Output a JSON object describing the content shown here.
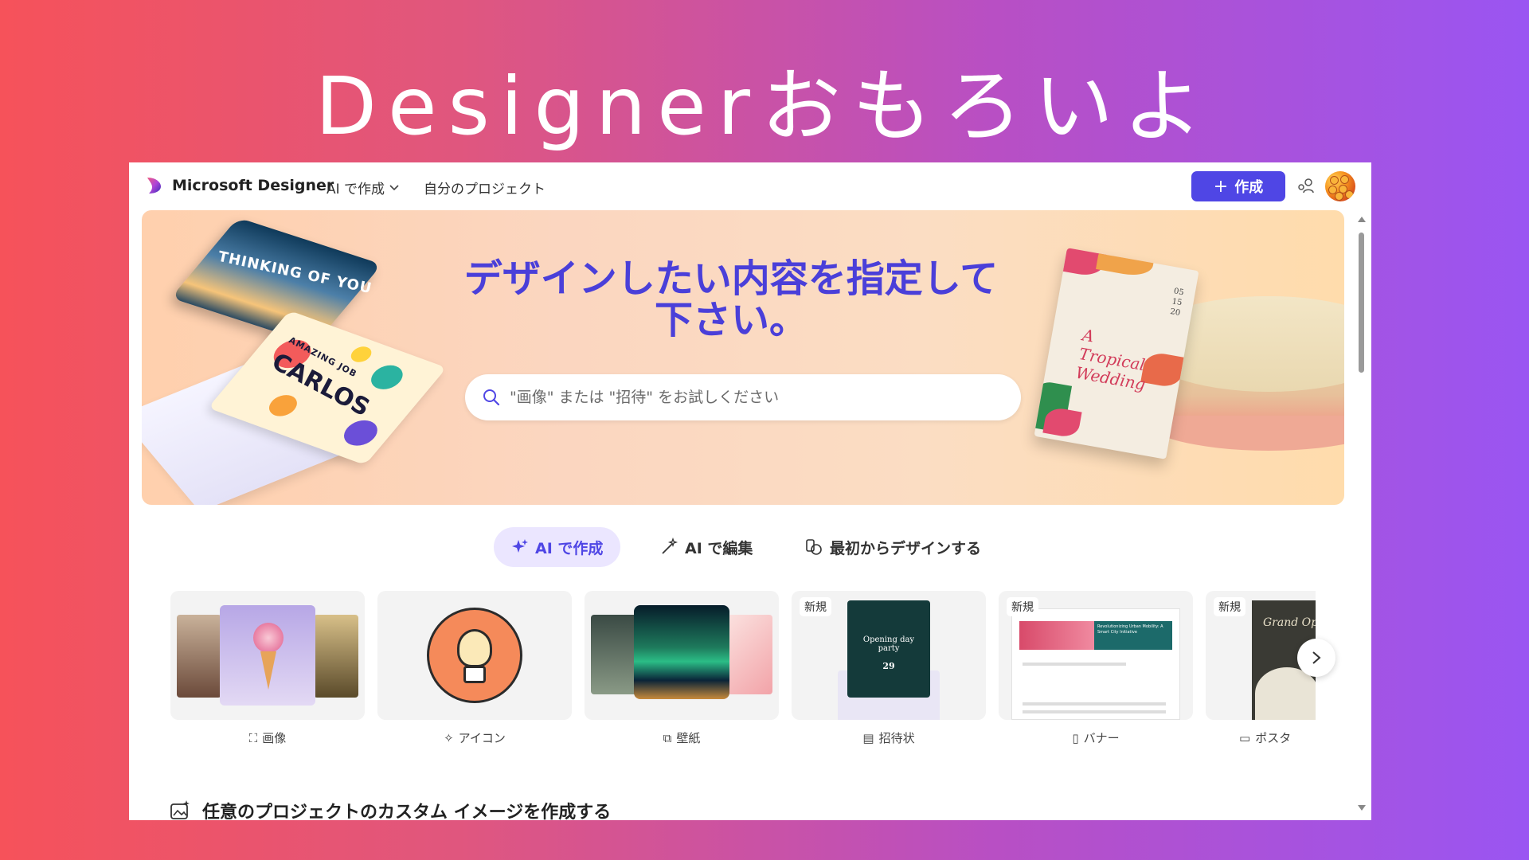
{
  "slide": {
    "title": "Designerおもろいよ"
  },
  "header": {
    "brand": "Microsoft Designer",
    "nav_ai": "AI で作成",
    "nav_projects": "自分のプロジェクト",
    "create_label": "作成"
  },
  "hero": {
    "headline_line1": "デザインしたい内容を指定して",
    "headline_line2": "下さい。",
    "search_placeholder": "\"画像\" または \"招待\" をお試しください",
    "card_sky_text": "THINKING OF YOU",
    "card_carlos_sub": "AMAZING JOB",
    "card_carlos_text": "CARLOS",
    "invite_title_line1": "A",
    "invite_title_line2": "Tropical",
    "invite_title_line3": "Wedding",
    "invite_date": "05\n15\n20"
  },
  "tabs": [
    {
      "label": "AI で作成",
      "active": true
    },
    {
      "label": "AI で編集",
      "active": false
    },
    {
      "label": "最初からデザインする",
      "active": false
    }
  ],
  "cards": [
    {
      "label": "画像",
      "badge": ""
    },
    {
      "label": "アイコン",
      "badge": ""
    },
    {
      "label": "壁紙",
      "badge": ""
    },
    {
      "label": "招待状",
      "badge": "新規",
      "thumb_text1": "Opening day",
      "thumb_text2": "party",
      "thumb_num": "29"
    },
    {
      "label": "バナー",
      "badge": "新規",
      "thumb_text1": "Revolutionizing Urban Mobility: A Smart City Initiative"
    },
    {
      "label": "ポスタ",
      "badge": "新規",
      "thumb_text1": "Grand Open"
    }
  ],
  "section": {
    "title": "任意のプロジェクトのカスタム イメージを作成する"
  },
  "colors": {
    "accent": "#4f46e5",
    "headline": "#4a3fd9",
    "tab_active_bg": "#ebe6ff"
  }
}
